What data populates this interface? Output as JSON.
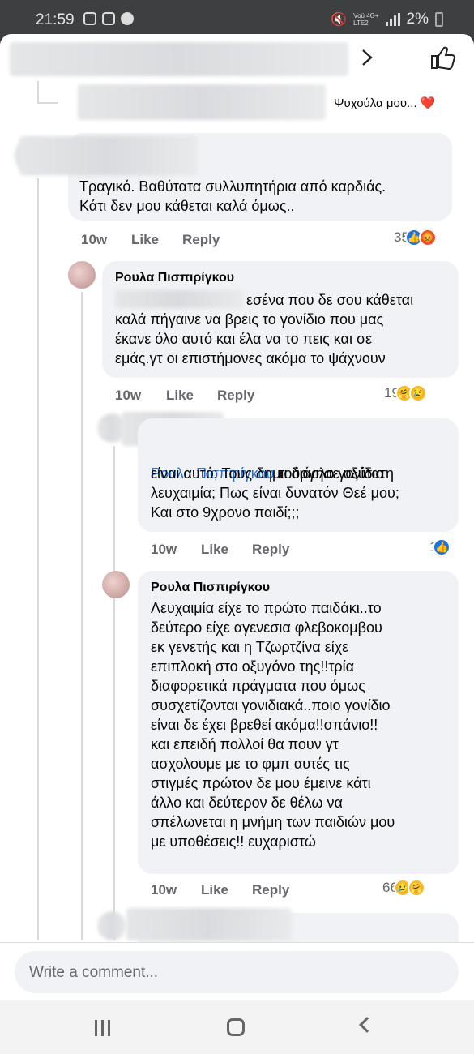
{
  "status_bar": {
    "time": "21:59",
    "carrier_small": "Voü 4G+\nLTE2",
    "battery": "2%"
  },
  "header": {
    "title": "",
    "chevron_icon": "chevron-right-icon",
    "like_icon": "thumbs-up-icon"
  },
  "previous_reply": {
    "text": "Ψυχούλα μου... ❤️"
  },
  "comments": [
    {
      "author": "",
      "text": "Τραγικό. Βαθύτατα συλλυπητήρια από καρδιάς.\nΚάτι δεν μου κάθεται καλά όμως..",
      "time": "10w",
      "like": "Like",
      "reply": "Reply",
      "reaction_count": "35",
      "reactions": [
        "like",
        "angry"
      ]
    },
    {
      "author": "Ρουλα Πισπιρίγκου",
      "text_start": "εσένα που δε σου κάθεται",
      "text": "καλά πήγαινε να βρεις το γονίδιο που μας\nέκανε όλο αυτό και έλα να το πεις και σε\nεμάς.γτ οι επιστήμονες ακόμα το ψάχνουν",
      "time": "10w",
      "like": "Like",
      "reply": "Reply",
      "reaction_count": "19",
      "reactions": [
        "care",
        "sad"
      ]
    },
    {
      "author": "",
      "mention": "Ρουλα Πισπιρίγκου",
      "text_first": " τι διάολο γονίδιο",
      "text": "είναι αυτό; Τους δημιούργησε οξύτατη\nλευχαιμία; Πως είναι δυνατόν Θεέ μου;\nΚαι στο 9χρονο παιδί;;;",
      "time": "10w",
      "like": "Like",
      "reply": "Reply",
      "reaction_count": "1",
      "reactions": [
        "like"
      ]
    },
    {
      "author": "Ρουλα Πισπιρίγκου",
      "text": "Λευχαιμία είχε το πρώτο παιδάκι..το\nδεύτερο είχε αγενεσια φλεβοκομβου\nεκ γενετής και η Τζωρτζίνα είχε\nεπιπλοκή στο οξυγόνο της!!τρία\nδιαφορετικά πράγματα που όμως\nσυσχετίζονται γονιδιακά..ποιο γονίδιο\nείναι δε έχει βρεθεί ακόμα!!σπάνιο!!\nκαι επειδή πολλοί θα πουν γτ\nασχολουμε με το φμπ αυτές τις\nστιγμές πρώτον δε μου έμεινε κάτι\nάλλο και δεύτερον δε θέλω να\nσπέλωνεται η μνήμη των παιδιών μου\nμε υποθέσεις!! ευχαριστώ",
      "time": "10w",
      "like": "Like",
      "reply": "Reply",
      "reaction_count": "66",
      "reactions": [
        "sad",
        "care"
      ]
    }
  ],
  "composer": {
    "placeholder": "Write a comment..."
  },
  "navbar": {
    "recent_icon": "recent-apps-icon",
    "home_icon": "home-icon",
    "back_icon": "back-icon"
  }
}
